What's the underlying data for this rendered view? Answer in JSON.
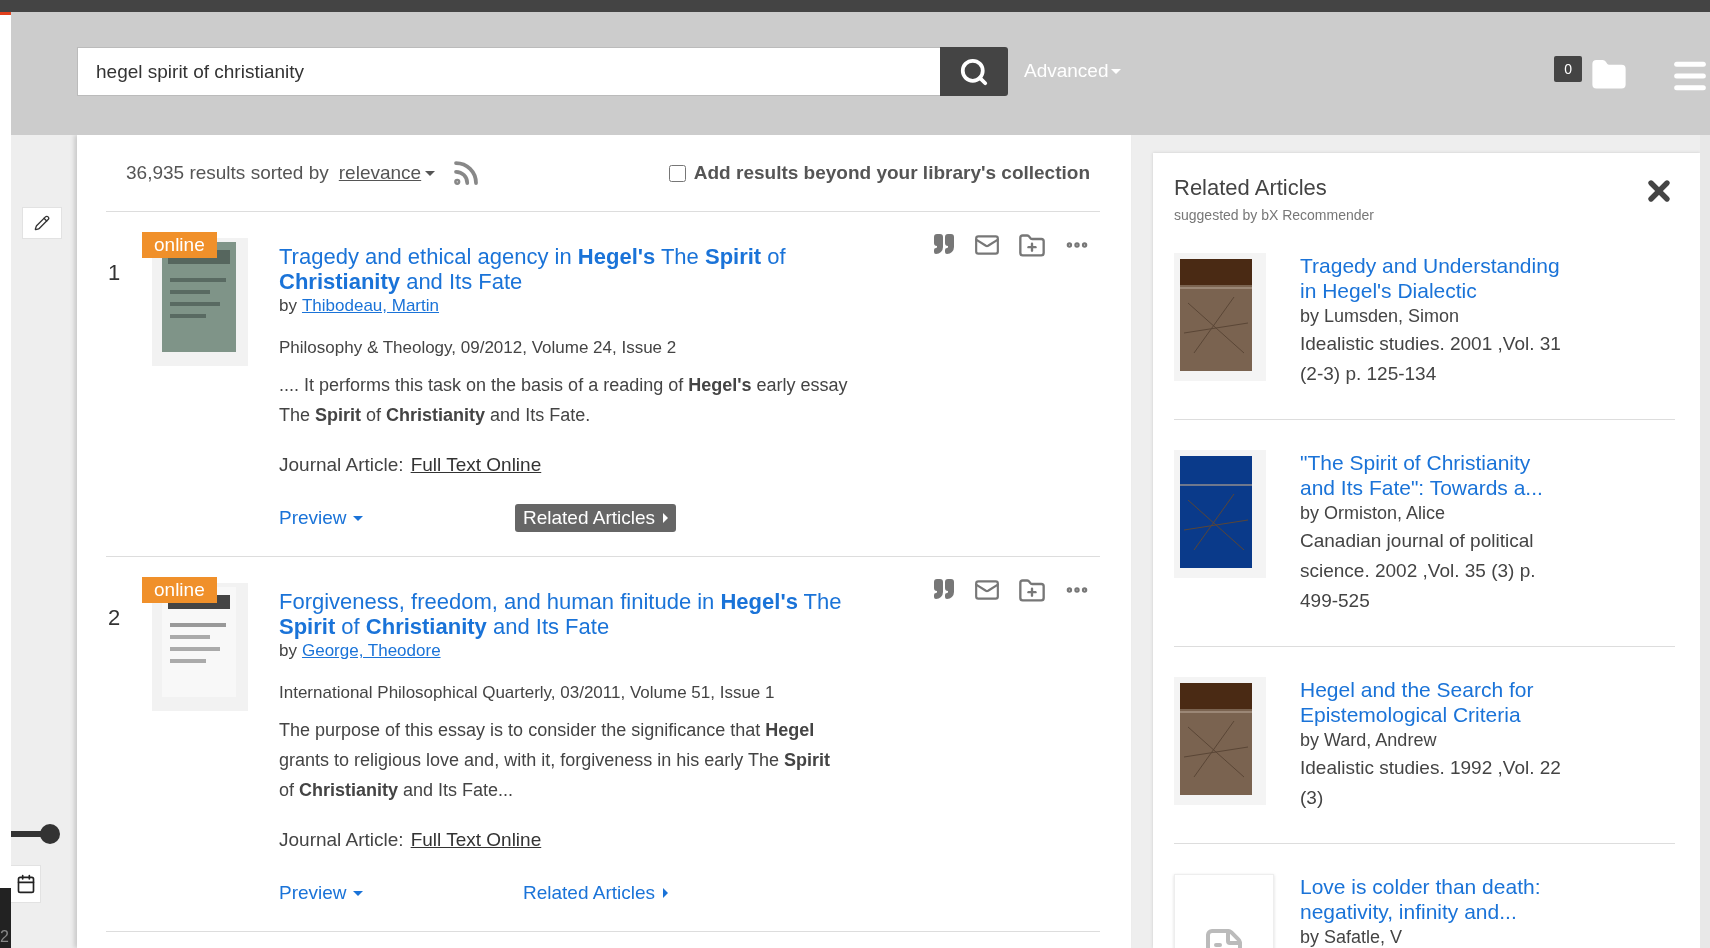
{
  "search": {
    "value": "hegel spirit of christianity"
  },
  "advanced": "Advanced",
  "folder_count": "0",
  "page_tab": "2",
  "results_header": {
    "count_text": "36,935 results sorted by",
    "sort": "relevance",
    "beyond": {
      "label": "Add results beyond your library's collection",
      "checked": false
    }
  },
  "results": [
    {
      "number": "1",
      "badge": "online",
      "title": "Tragedy and ethical agency in **Hegel's** The **Spirit** of **Christianity** and Its Fate",
      "author_prefix": "by",
      "author": "Thibodeau, Martin",
      "source": "Philosophy & Theology, 09/2012, Volume 24, Issue 2",
      "snippet": ".... It performs this task on the basis of a reading of **Hegel's** early essay The **Spirit** of **Christianity** and Its Fate.",
      "format": "Journal Article:",
      "access": "Full Text Online",
      "preview": "Preview",
      "related": {
        "label": "Related Articles",
        "selected": true
      }
    },
    {
      "number": "2",
      "badge": "online",
      "title": "Forgiveness, freedom, and human finitude in **Hegel's** The **Spirit** of **Christianity** and Its Fate",
      "author_prefix": "by",
      "author": "George, Theodore",
      "source": "International Philosophical Quarterly, 03/2011, Volume 51, Issue 1",
      "snippet": "The purpose of this essay is to consider the significance that **Hegel** grants to religious love and, with it, forgiveness in his early The **Spirit** of **Christianity** and Its Fate...",
      "format": "Journal Article:",
      "access": "Full Text Online",
      "preview": "Preview",
      "related": {
        "label": "Related Articles",
        "selected": false
      }
    }
  ],
  "related_panel": {
    "title": "Related Articles",
    "subtitle": "suggested by bX Recommender",
    "items": [
      {
        "kind": "picture",
        "title": "Tragedy and Understanding in Hegel's Dialectic",
        "author": "by Lumsden, Simon",
        "citation": "Idealistic studies. 2001 ,Vol. 31 (2-3) p. 125-134"
      },
      {
        "kind": "picture",
        "title": "\"The Spirit of Christianity and Its Fate\": Towards a...",
        "author": "by Ormiston, Alice",
        "citation": "Canadian journal of political science. 2002 ,Vol. 35 (3) p. 499-525"
      },
      {
        "kind": "picture",
        "title": "Hegel and the Search for Epistemological Criteria",
        "author": "by Ward, Andrew",
        "citation": "Idealistic studies. 1992 ,Vol. 22 (3)"
      },
      {
        "kind": "document",
        "title": "Love is colder than death: negativity, infinity and...",
        "author": "by Safatle, V"
      }
    ]
  }
}
